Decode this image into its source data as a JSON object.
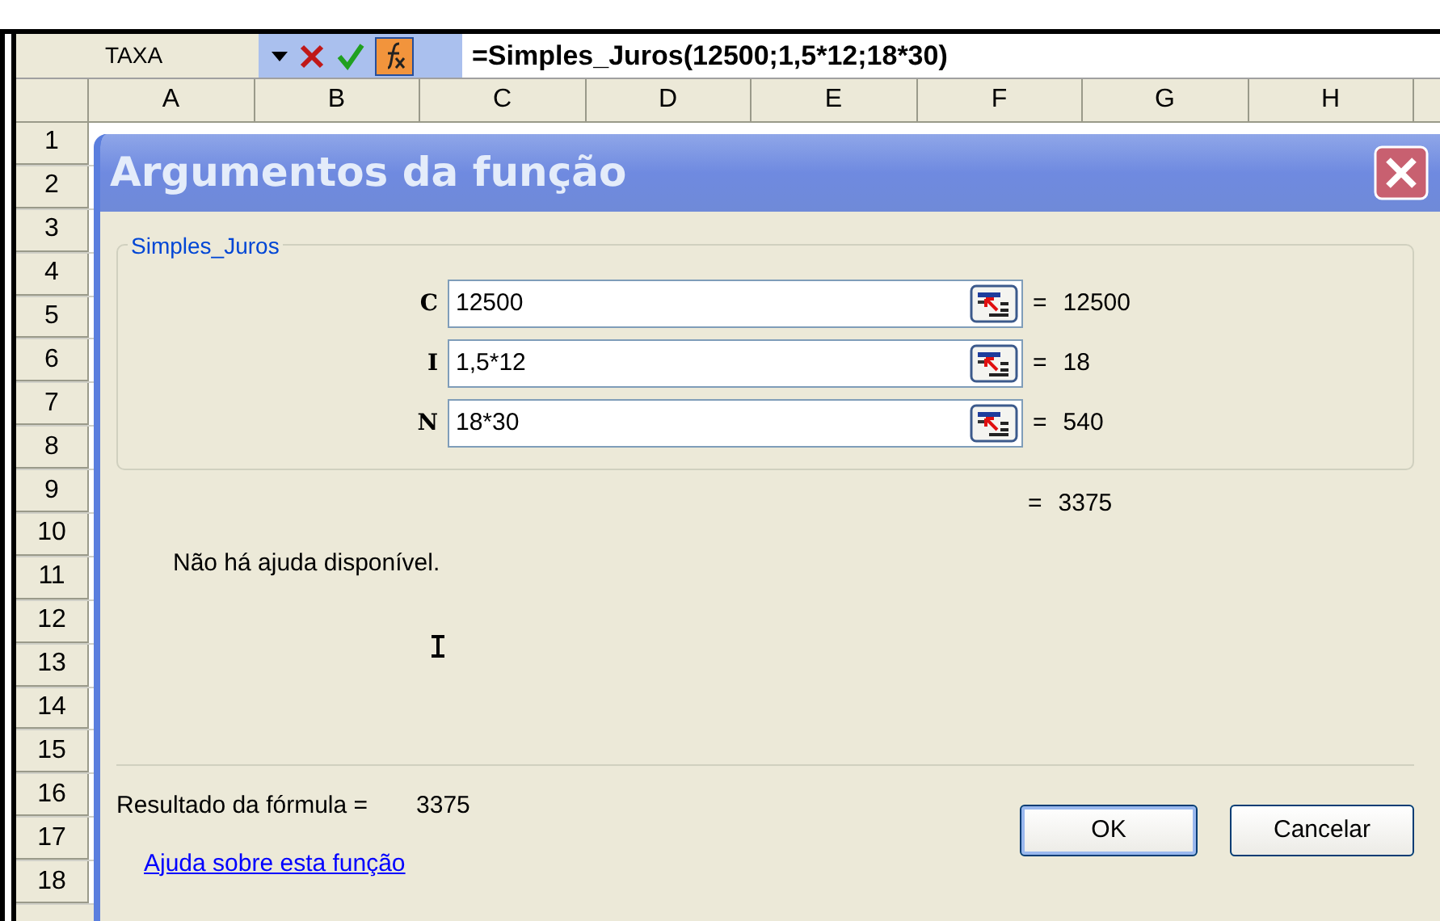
{
  "formula_bar": {
    "name_box": "TAXA",
    "formula": "=Simples_Juros(12500;1,5*12;18*30)"
  },
  "sheet": {
    "columns": [
      "A",
      "B",
      "C",
      "D",
      "E",
      "F",
      "G",
      "H"
    ],
    "rows": [
      "1",
      "2",
      "3",
      "4",
      "5",
      "6",
      "7",
      "8",
      "9",
      "10",
      "11",
      "12",
      "13",
      "14",
      "15",
      "16",
      "17",
      "18"
    ]
  },
  "dialog": {
    "title": "Argumentos da função",
    "group_label": "Simples_Juros",
    "arguments": [
      {
        "name": "C",
        "value": "12500",
        "equals": "=",
        "result": "12500"
      },
      {
        "name": "I",
        "value": "1,5*12",
        "equals": "=",
        "result": "18"
      },
      {
        "name": "N",
        "value": "18*30",
        "equals": "=",
        "result": "540"
      }
    ],
    "function_result": {
      "equals": "=",
      "value": "3375"
    },
    "help_text": "Não há ajuda disponível.",
    "formula_result_label": "Resultado da fórmula =",
    "formula_result": "3375",
    "help_link": "Ajuda sobre esta função",
    "buttons": [
      "OK",
      "Cancelar"
    ]
  }
}
